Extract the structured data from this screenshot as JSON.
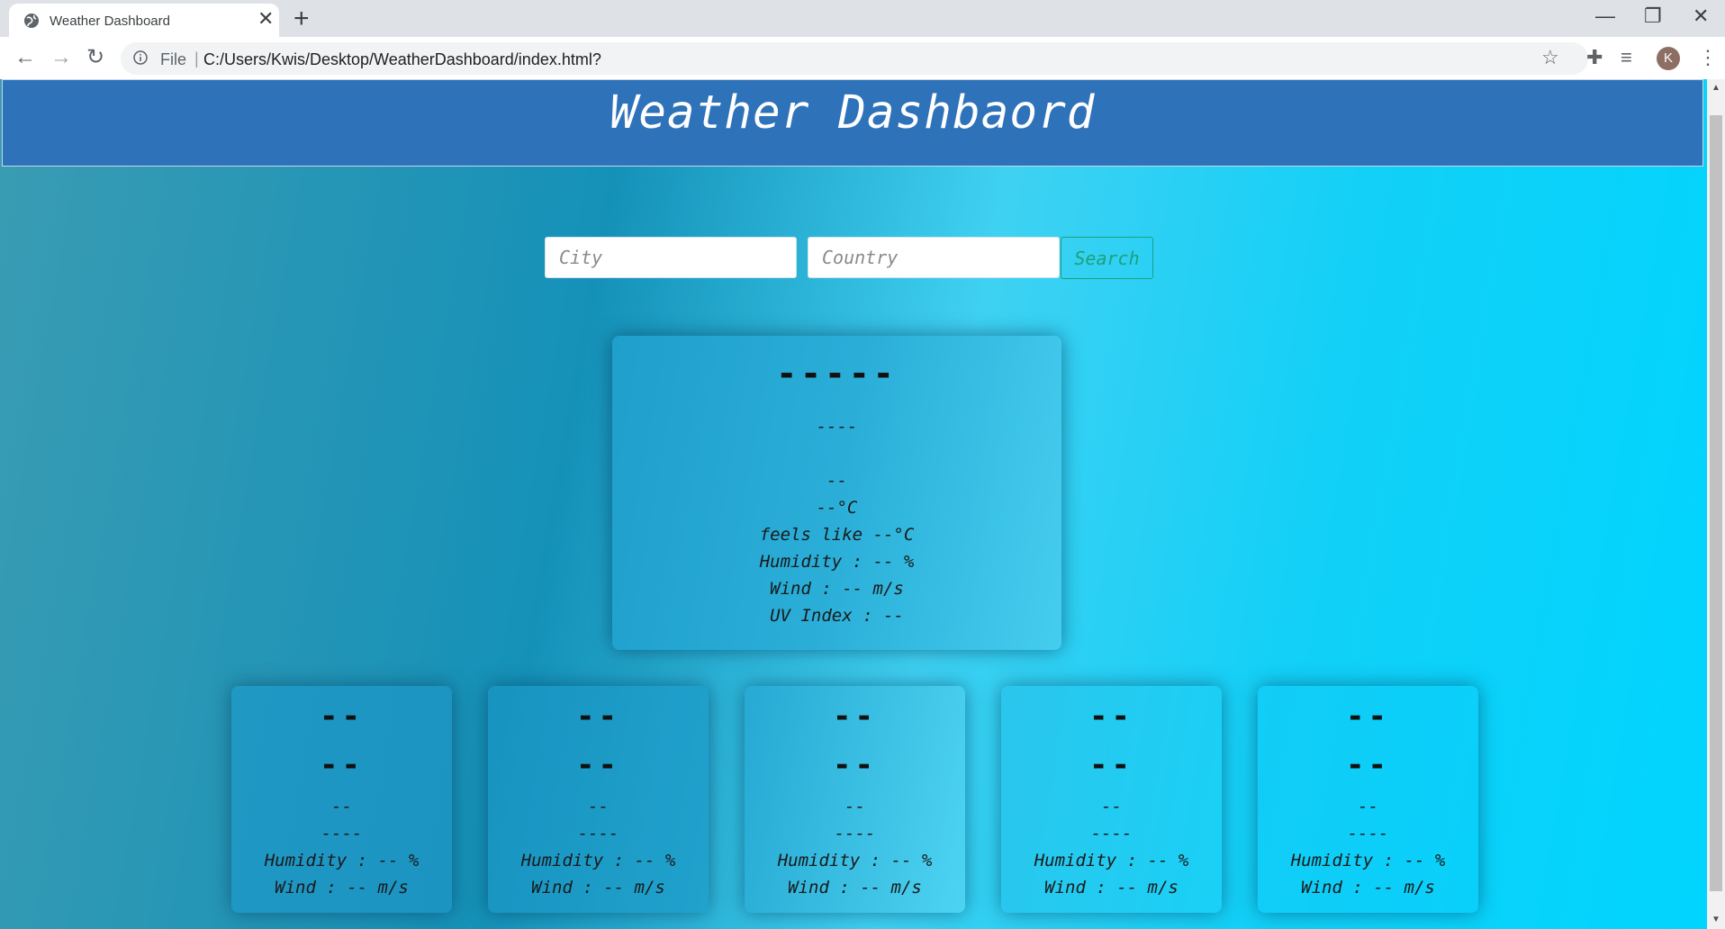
{
  "browser": {
    "tab_title": "Weather Dashboard",
    "scheme_label": "File",
    "url": "C:/Users/Kwis/Desktop/WeatherDashboard/index.html?",
    "profile_initial": "K"
  },
  "header": {
    "title": "Weather Dashbaord"
  },
  "search": {
    "city_placeholder": "City",
    "country_placeholder": "Country",
    "button_label": "Search"
  },
  "current": {
    "city": "-----",
    "date": "----",
    "description": "--",
    "temperature": "--°C",
    "feels_like": "feels like --°C",
    "humidity": "Humidity : -- %",
    "wind": "Wind : -- m/s",
    "uv_index": "UV Index : --"
  },
  "forecast": [
    {
      "day": "--",
      "icon": "--",
      "description": "--",
      "temp": "----",
      "humidity": "Humidity : -- %",
      "wind": "Wind : -- m/s"
    },
    {
      "day": "--",
      "icon": "--",
      "description": "--",
      "temp": "----",
      "humidity": "Humidity : -- %",
      "wind": "Wind : -- m/s"
    },
    {
      "day": "--",
      "icon": "--",
      "description": "--",
      "temp": "----",
      "humidity": "Humidity : -- %",
      "wind": "Wind : -- m/s"
    },
    {
      "day": "--",
      "icon": "--",
      "description": "--",
      "temp": "----",
      "humidity": "Humidity : -- %",
      "wind": "Wind : -- m/s"
    },
    {
      "day": "--",
      "icon": "--",
      "description": "--",
      "temp": "----",
      "humidity": "Humidity : -- %",
      "wind": "Wind : -- m/s"
    }
  ],
  "colors": {
    "header_bg": "#2e72b9",
    "search_accent": "#19a27a"
  }
}
